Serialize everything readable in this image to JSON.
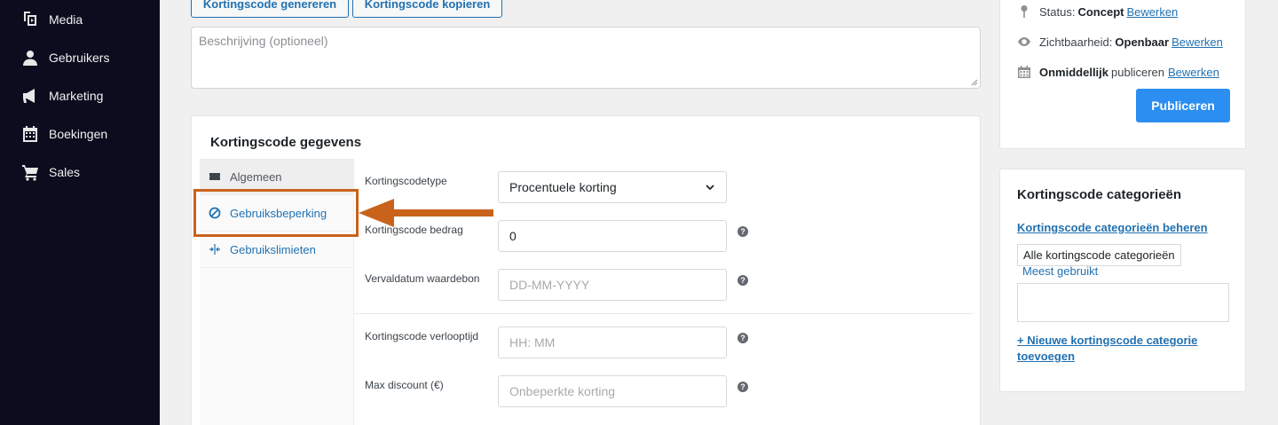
{
  "sidebar": {
    "items": [
      {
        "label": "Media",
        "icon": "media-icon"
      },
      {
        "label": "Gebruikers",
        "icon": "user-icon"
      },
      {
        "label": "Marketing",
        "icon": "megaphone-icon"
      },
      {
        "label": "Boekingen",
        "icon": "calendar-icon"
      },
      {
        "label": "Sales",
        "icon": "cart-icon"
      }
    ]
  },
  "toolbar": {
    "generate_label": "Kortingscode genereren",
    "copy_label": "Kortingscode kopieren"
  },
  "description": {
    "placeholder": "Beschrijving (optioneel)"
  },
  "coupon_panel": {
    "title": "Kortingscode gegevens",
    "tabs": [
      {
        "label": "Algemeen",
        "icon": "ticket-icon",
        "active": true
      },
      {
        "label": "Gebruiksbeperking",
        "icon": "block-icon",
        "active": false
      },
      {
        "label": "Gebruikslimieten",
        "icon": "limits-icon",
        "active": false
      }
    ],
    "fields": {
      "type": {
        "label": "Kortingscodetype",
        "value": "Procentuele korting"
      },
      "amount": {
        "label": "Kortingscode bedrag",
        "value": "0"
      },
      "expiry_date": {
        "label": "Vervaldatum waardebon",
        "placeholder": "DD-MM-YYYY"
      },
      "expiry_time": {
        "label": "Kortingscode verlooptijd",
        "placeholder": "HH: MM"
      },
      "max_discount": {
        "label": "Max discount (€)",
        "placeholder": "Onbeperkte korting"
      }
    },
    "help_glyph": "?"
  },
  "publish_box": {
    "status_label": "Status:",
    "status_value": "Concept",
    "visibility_label": "Zichtbaarheid:",
    "visibility_value": "Openbaar",
    "schedule_value": "Onmiddellijk",
    "schedule_label": "publiceren",
    "edit_link": "Bewerken",
    "publish_button": "Publiceren"
  },
  "categories_box": {
    "title": "Kortingscode categorieën",
    "manage_link": "Kortingscode categorieën beheren",
    "tab_all": "Alle kortingscode categorieën",
    "tab_most_used": "Meest gebruikt",
    "add_link_line1": "+ Nieuwe kortingscode categorie",
    "add_link_line2": "toevoegen"
  },
  "colors": {
    "sidebar_bg": "#0b0d1e",
    "accent": "#2271b1",
    "publish_button": "#2b8ef0",
    "annotation": "#c9621b"
  }
}
